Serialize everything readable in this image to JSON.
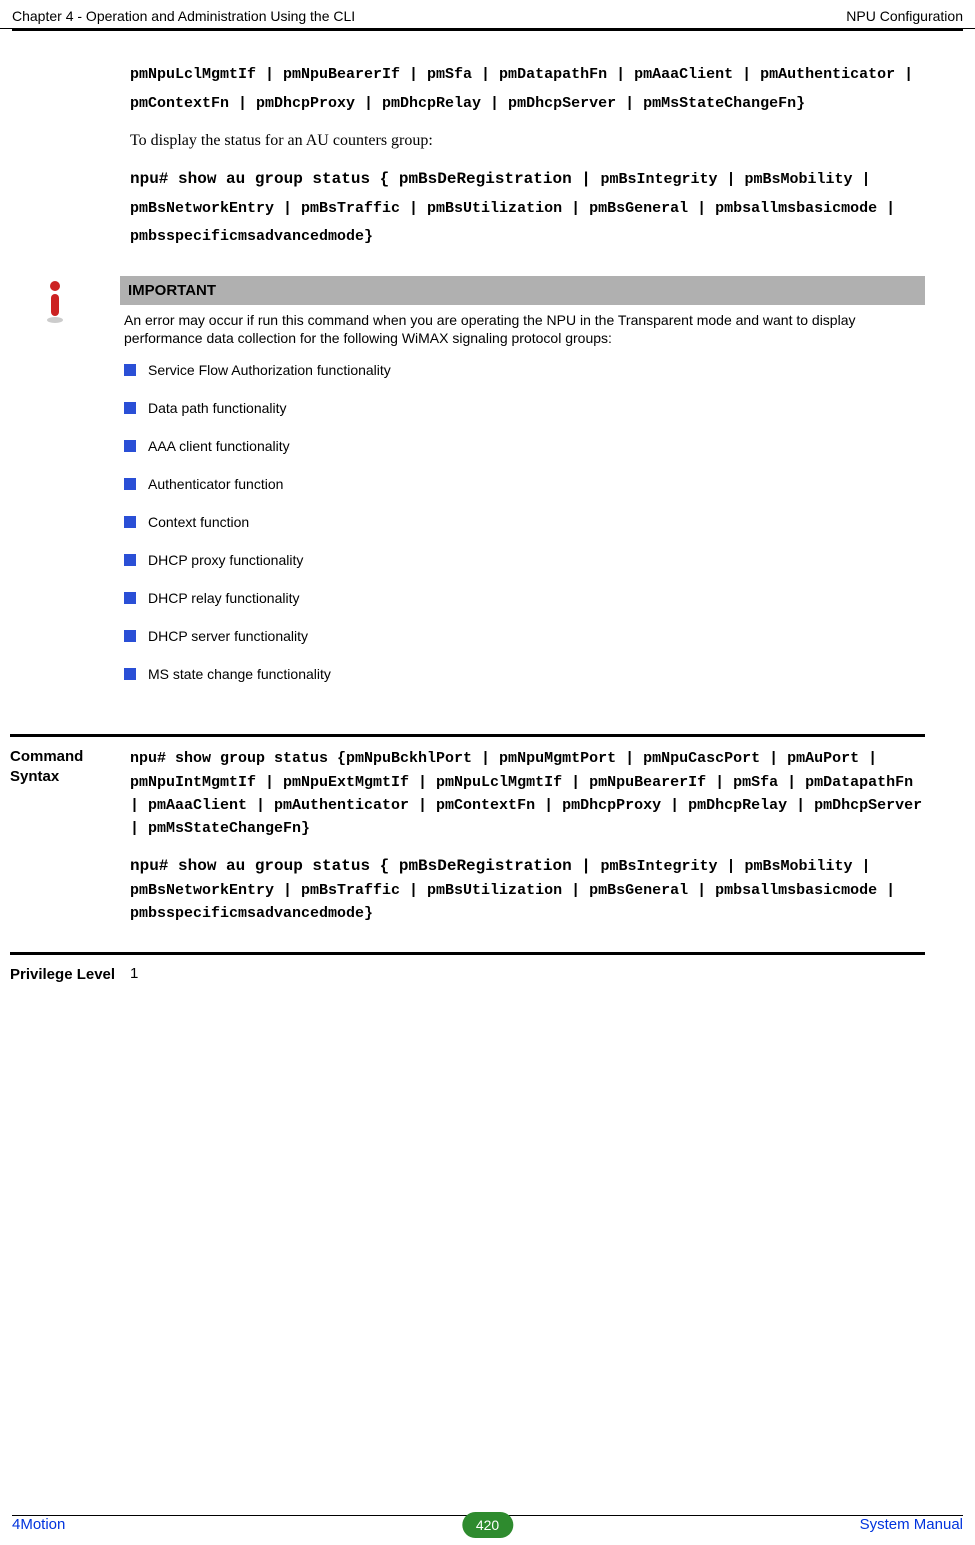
{
  "header": {
    "left": "Chapter 4 - Operation and Administration Using the CLI",
    "right": "NPU Configuration"
  },
  "block_npu_options_cont": "pmNpuLclMgmtIf | pmNpuBearerIf | pmSfa | pmDatapathFn | pmAaaClient | pmAuthenticator | pmContextFn | pmDhcpProxy | pmDhcpRelay | pmDhcpServer | pmMsStateChangeFn}",
  "serif_intro": "To display the status for an AU counters group:",
  "block_au_cmd_prefix": "npu# show au group status { pmBsDeRegistration | ",
  "block_au_cmd_rest": "pmBsIntegrity | pmBsMobility | pmBsNetworkEntry | pmBsTraffic | pmBsUtilization | pmBsGeneral | pmbsallmsbasicmode | pmbsspecificmsadvancedmode}",
  "important": {
    "title": "IMPORTANT",
    "desc": "An error may occur if run this command when you are operating the NPU in the Transparent mode and want to display performance data collection for the following WiMAX signaling protocol groups:",
    "bullets": [
      "Service Flow Authorization functionality",
      "Data path functionality",
      "AAA client functionality",
      "Authenticator function",
      "Context function",
      "DHCP proxy functionality",
      "DHCP relay functionality",
      "DHCP server functionality",
      "MS state change functionality"
    ]
  },
  "command_syntax": {
    "label": "Command Syntax",
    "npu_cmd": "npu# show group status {pmNpuBckhlPort | pmNpuMgmtPort | pmNpuCascPort | pmAuPort | pmNpuIntMgmtIf | pmNpuExtMgmtIf | pmNpuLclMgmtIf | pmNpuBearerIf | pmSfa | pmDatapathFn | pmAaaClient | pmAuthenticator | pmContextFn | pmDhcpProxy | pmDhcpRelay | pmDhcpServer | pmMsStateChangeFn}",
    "au_cmd_prefix": "npu# show au group status { pmBsDeRegistration | ",
    "au_cmd_rest": "pmBsIntegrity | pmBsMobility | pmBsNetworkEntry | pmBsTraffic | pmBsUtilization | pmBsGeneral | pmbsallmsbasicmode | pmbsspecificmsadvancedmode}"
  },
  "privilege": {
    "label": "Privilege Level",
    "value": "1"
  },
  "footer": {
    "left": "4Motion",
    "page": "420",
    "right": "System Manual"
  }
}
